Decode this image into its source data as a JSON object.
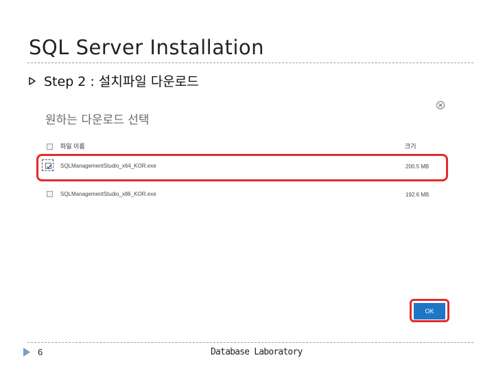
{
  "slide": {
    "title": "SQL Server Installation",
    "bullet": "Step 2 : 설치파일 다운로드",
    "page_number": "6",
    "footer": "Database Laboratory"
  },
  "dialog": {
    "title": "원하는 다운로드 선택",
    "header_name": "파일 이름",
    "header_size": "크기",
    "files": [
      {
        "name": "SQLManagementStudio_x64_KOR.exe",
        "size": "200.5 MB",
        "checked": true
      },
      {
        "name": "SQLManagementStudio_x86_KOR.exe",
        "size": "192.6 MB",
        "checked": false
      }
    ],
    "ok_label": "OK"
  },
  "colors": {
    "highlight": "#e12a2a",
    "ok_button": "#1f76c4",
    "bullet_arrow": "#1a1a1a"
  },
  "icons": {
    "close": "close-circle-icon",
    "bullet": "triangle-right-icon",
    "page": "triangle-right-icon"
  }
}
